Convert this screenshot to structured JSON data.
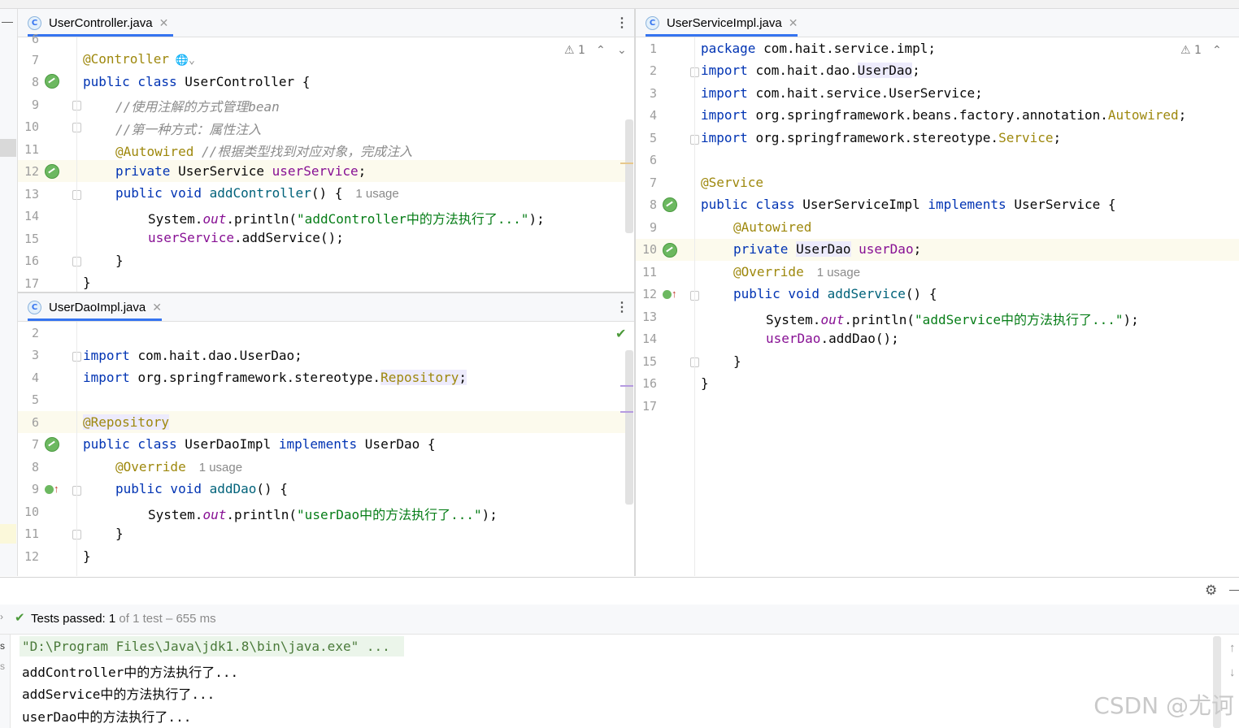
{
  "editors": {
    "left_top": {
      "tab": "UserController.java",
      "tab_icon": "C",
      "warnings": "1",
      "line_numbers": [
        "6",
        "7",
        "8",
        "9",
        "10",
        "11",
        "12",
        "13",
        "14",
        "15",
        "16",
        "17"
      ],
      "lines": {
        "l7": "@Controller",
        "l8_kw": "public class ",
        "l8_name": "UserController {",
        "l9": "//使用注解的方式管理bean",
        "l10": "//第一种方式：属性注入",
        "l11_an": "@Autowired",
        "l11_cm": " //根据类型找到对应对象，完成注入",
        "l12_kw": "private ",
        "l12_type": "UserService ",
        "l12_field": "userService",
        "l12_end": ";",
        "l13_kw": "public void ",
        "l13_fn": "addController",
        "l13_end": "() {",
        "l13_hint": "1 usage",
        "l14_a": "System.",
        "l14_out": "out",
        "l14_b": ".println(",
        "l14_str": "\"addController中的方法执行了...\"",
        "l14_c": ");",
        "l15_field": "userService",
        "l15_end": ".addService();",
        "l16": "}",
        "l17": "}"
      }
    },
    "left_bottom": {
      "tab": "UserDaoImpl.java",
      "tab_icon": "C",
      "line_numbers": [
        "2",
        "3",
        "4",
        "5",
        "6",
        "7",
        "8",
        "9",
        "10",
        "11",
        "12"
      ],
      "lines": {
        "l3_kw": "import ",
        "l3_rest": "com.hait.dao.UserDao;",
        "l4_kw": "import ",
        "l4_a": "org.springframework.stereotype.",
        "l4_an": "Repository",
        "l4_end": ";",
        "l6": "@Repository",
        "l7_kw": "public class ",
        "l7_name": "UserDaoImpl ",
        "l7_kw2": "implements ",
        "l7_end": "UserDao {",
        "l8_an": "@Override",
        "l8_hint": "1 usage",
        "l9_kw": "public void ",
        "l9_fn": "addDao",
        "l9_end": "() {",
        "l10_a": "System.",
        "l10_out": "out",
        "l10_b": ".println(",
        "l10_str": "\"userDao中的方法执行了...\"",
        "l10_c": ");",
        "l11": "}",
        "l12": "}"
      }
    },
    "right": {
      "tab": "UserServiceImpl.java",
      "tab_icon": "C",
      "warnings": "1",
      "line_numbers": [
        "1",
        "2",
        "3",
        "4",
        "5",
        "6",
        "7",
        "8",
        "9",
        "10",
        "11",
        "12",
        "13",
        "14",
        "15",
        "16",
        "17"
      ],
      "lines": {
        "l1_kw": "package ",
        "l1_rest": "com.hait.service.impl;",
        "l2_kw": "import ",
        "l2_a": "com.hait.dao.",
        "l2_b": "UserDao",
        "l2_end": ";",
        "l3_kw": "import ",
        "l3_rest": "com.hait.service.UserService;",
        "l4_kw": "import ",
        "l4_a": "org.springframework.beans.factory.annotation.",
        "l4_an": "Autowired",
        "l4_end": ";",
        "l5_kw": "import ",
        "l5_a": "org.springframework.stereotype.",
        "l5_an": "Service",
        "l5_end": ";",
        "l7": "@Service",
        "l8_kw": "public class ",
        "l8_name": "UserServiceImpl ",
        "l8_kw2": "implements ",
        "l8_end": "UserService {",
        "l9": "@Autowired",
        "l10_kw": "private ",
        "l10_type": "UserDao",
        "l10_field": "userDao",
        "l10_end": ";",
        "l11_an": "@Override",
        "l11_hint": "1 usage",
        "l12_kw": "public void ",
        "l12_fn": "addService",
        "l12_end": "() {",
        "l13_a": "System.",
        "l13_out": "out",
        "l13_b": ".println(",
        "l13_str": "\"addService中的方法执行了...\"",
        "l13_c": ");",
        "l14_field": "userDao",
        "l14_end": ".addDao();",
        "l15": "}",
        "l16": "}"
      }
    }
  },
  "run": {
    "status_passed": "Tests passed:",
    "status_count": "1",
    "status_rest": "of 1 test – 655 ms",
    "output": [
      "\"D:\\Program Files\\Java\\jdk1.8\\bin\\java.exe\" ...",
      "addController中的方法执行了...",
      "addService中的方法执行了...",
      "userDao中的方法执行了..."
    ]
  },
  "watermark": "CSDN @尤诃",
  "colors": {
    "keyword": "#0033b3",
    "annotation": "#9e880d",
    "string": "#067d17",
    "field": "#871094",
    "accent": "#3574f0"
  }
}
